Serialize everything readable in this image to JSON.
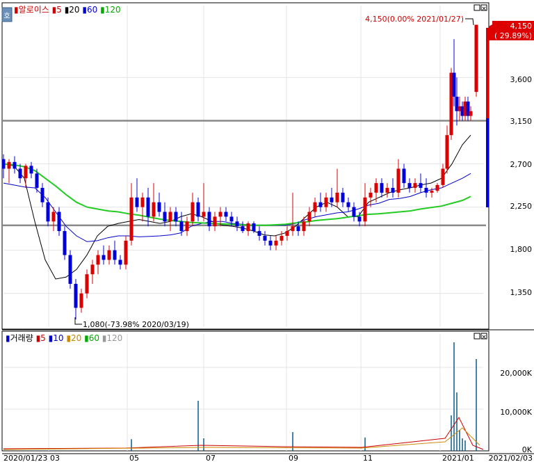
{
  "price_panel": {
    "legend": [
      {
        "text": "알로이스",
        "color": "#cc0000"
      },
      {
        "text": "5",
        "color": "#cc0000"
      },
      {
        "text": "20",
        "color": "#000000"
      },
      {
        "text": "60",
        "color": "#0000cc"
      },
      {
        "text": "120",
        "color": "#00aa00"
      }
    ],
    "side_button": "호",
    "high_annotation": "4,150(0.00% 2021/01/27)",
    "low_annotation": "1,080(-73.98% 2020/03/19)",
    "current_price": "4,150",
    "current_change": "( 29.89%)",
    "y_ticks": [
      "3,600",
      "3,150",
      "2,700",
      "2,250",
      "1,800",
      "1,350"
    ]
  },
  "volume_panel": {
    "legend": [
      {
        "text": "거래량",
        "color": "#000000"
      },
      {
        "text": "5",
        "color": "#cc0000"
      },
      {
        "text": "10",
        "color": "#0000cc"
      },
      {
        "text": "20",
        "color": "#cc8800"
      },
      {
        "text": "60",
        "color": "#00aa00"
      },
      {
        "text": "120",
        "color": "#999999"
      }
    ],
    "y_ticks": [
      "20,000K",
      "10,000K",
      "0K"
    ]
  },
  "x_axis": {
    "labels": [
      "2020/01/23",
      "03",
      "05",
      "07",
      "09",
      "11",
      "2021/01",
      "2021/02/03"
    ]
  },
  "colors": {
    "up": "#dd0000",
    "down": "#0000dd",
    "ma5": "#cc0000",
    "ma20": "#000000",
    "ma60": "#0000cc",
    "ma120": "#22cc22",
    "hline": "#888888"
  },
  "chart_data": {
    "type": "candlestick",
    "y_range": [
      1000,
      4350
    ],
    "volume_y_range_k": [
      0,
      28000
    ],
    "horizontal_lines": [
      3150,
      2060
    ],
    "high": {
      "value": 4150,
      "date": "2021/01/27"
    },
    "low": {
      "value": 1080,
      "date": "2020/03/19"
    },
    "last_close": 4150,
    "ma_series": {
      "ma20": [
        [
          0,
          2700
        ],
        [
          15,
          2680
        ],
        [
          30,
          2550
        ],
        [
          45,
          2100
        ],
        [
          60,
          1700
        ],
        [
          75,
          1500
        ],
        [
          90,
          1520
        ],
        [
          105,
          1600
        ],
        [
          120,
          1750
        ],
        [
          135,
          1950
        ],
        [
          150,
          2050
        ],
        [
          165,
          2080
        ],
        [
          180,
          2100
        ],
        [
          195,
          2120
        ],
        [
          210,
          2100
        ],
        [
          225,
          2080
        ],
        [
          240,
          2100
        ],
        [
          255,
          2150
        ],
        [
          270,
          2180
        ],
        [
          285,
          2150
        ],
        [
          300,
          2100
        ],
        [
          315,
          2060
        ],
        [
          330,
          2050
        ],
        [
          345,
          2030
        ],
        [
          360,
          2000
        ],
        [
          375,
          1960
        ],
        [
          390,
          1950
        ],
        [
          405,
          1980
        ],
        [
          420,
          2050
        ],
        [
          435,
          2150
        ],
        [
          450,
          2250
        ],
        [
          465,
          2300
        ],
        [
          480,
          2250
        ],
        [
          495,
          2150
        ],
        [
          510,
          2150
        ],
        [
          525,
          2300
        ],
        [
          540,
          2350
        ],
        [
          555,
          2400
        ],
        [
          570,
          2430
        ],
        [
          585,
          2450
        ],
        [
          600,
          2480
        ],
        [
          615,
          2500
        ],
        [
          630,
          2550
        ],
        [
          645,
          2700
        ],
        [
          660,
          2900
        ],
        [
          672,
          3000
        ]
      ],
      "ma60": [
        [
          0,
          2500
        ],
        [
          15,
          2480
        ],
        [
          30,
          2460
        ],
        [
          45,
          2450
        ],
        [
          60,
          2350
        ],
        [
          75,
          2200
        ],
        [
          90,
          2050
        ],
        [
          105,
          1950
        ],
        [
          120,
          1890
        ],
        [
          135,
          1900
        ],
        [
          150,
          1930
        ],
        [
          165,
          1950
        ],
        [
          180,
          1950
        ],
        [
          195,
          1940
        ],
        [
          210,
          1945
        ],
        [
          225,
          1950
        ],
        [
          240,
          1960
        ],
        [
          255,
          1980
        ],
        [
          270,
          2050
        ],
        [
          285,
          2080
        ],
        [
          300,
          2100
        ],
        [
          315,
          2100
        ],
        [
          330,
          2080
        ],
        [
          345,
          2070
        ],
        [
          360,
          2060
        ],
        [
          375,
          2060
        ],
        [
          390,
          2060
        ],
        [
          405,
          2060
        ],
        [
          420,
          2080
        ],
        [
          435,
          2120
        ],
        [
          450,
          2150
        ],
        [
          465,
          2170
        ],
        [
          480,
          2190
        ],
        [
          495,
          2200
        ],
        [
          510,
          2230
        ],
        [
          525,
          2270
        ],
        [
          540,
          2290
        ],
        [
          555,
          2330
        ],
        [
          570,
          2340
        ],
        [
          585,
          2360
        ],
        [
          600,
          2400
        ],
        [
          615,
          2430
        ],
        [
          630,
          2450
        ],
        [
          645,
          2500
        ],
        [
          660,
          2550
        ],
        [
          672,
          2600
        ]
      ],
      "ma120": [
        [
          0,
          2700
        ],
        [
          15,
          2690
        ],
        [
          30,
          2670
        ],
        [
          45,
          2630
        ],
        [
          60,
          2550
        ],
        [
          75,
          2470
        ],
        [
          90,
          2380
        ],
        [
          105,
          2300
        ],
        [
          120,
          2250
        ],
        [
          135,
          2230
        ],
        [
          150,
          2210
        ],
        [
          165,
          2200
        ],
        [
          180,
          2180
        ],
        [
          195,
          2165
        ],
        [
          210,
          2145
        ],
        [
          225,
          2125
        ],
        [
          240,
          2110
        ],
        [
          255,
          2100
        ],
        [
          270,
          2090
        ],
        [
          285,
          2085
        ],
        [
          300,
          2080
        ],
        [
          315,
          2075
        ],
        [
          330,
          2070
        ],
        [
          345,
          2065
        ],
        [
          360,
          2060
        ],
        [
          375,
          2060
        ],
        [
          390,
          2065
        ],
        [
          405,
          2070
        ],
        [
          420,
          2085
        ],
        [
          435,
          2095
        ],
        [
          450,
          2110
        ],
        [
          465,
          2120
        ],
        [
          480,
          2130
        ],
        [
          495,
          2145
        ],
        [
          510,
          2160
        ],
        [
          525,
          2175
        ],
        [
          540,
          2180
        ],
        [
          555,
          2190
        ],
        [
          570,
          2200
        ],
        [
          585,
          2210
        ],
        [
          600,
          2230
        ],
        [
          615,
          2245
        ],
        [
          630,
          2260
        ],
        [
          645,
          2290
        ],
        [
          660,
          2320
        ],
        [
          672,
          2360
        ]
      ]
    },
    "candles": [
      [
        0,
        2750,
        2800,
        2550,
        2650
      ],
      [
        8,
        2650,
        2750,
        2500,
        2720
      ],
      [
        16,
        2720,
        2780,
        2600,
        2650
      ],
      [
        24,
        2650,
        2700,
        2500,
        2550
      ],
      [
        32,
        2550,
        2700,
        2450,
        2680
      ],
      [
        40,
        2680,
        2720,
        2550,
        2600
      ],
      [
        48,
        2600,
        2650,
        2400,
        2450
      ],
      [
        56,
        2450,
        2500,
        2250,
        2300
      ],
      [
        64,
        2300,
        2350,
        2050,
        2100
      ],
      [
        72,
        2100,
        2250,
        2000,
        2200
      ],
      [
        80,
        2200,
        2250,
        1950,
        2000
      ],
      [
        88,
        2000,
        2050,
        1700,
        1750
      ],
      [
        96,
        1750,
        1800,
        1400,
        1450
      ],
      [
        104,
        1450,
        1500,
        1080,
        1200
      ],
      [
        112,
        1200,
        1400,
        1150,
        1350
      ],
      [
        120,
        1350,
        1600,
        1300,
        1550
      ],
      [
        128,
        1550,
        1700,
        1450,
        1650
      ],
      [
        136,
        1650,
        1800,
        1550,
        1750
      ],
      [
        144,
        1750,
        1850,
        1650,
        1700
      ],
      [
        152,
        1700,
        1850,
        1650,
        1800
      ],
      [
        160,
        1800,
        1900,
        1650,
        1700
      ],
      [
        168,
        1700,
        1750,
        1600,
        1650
      ],
      [
        176,
        1650,
        1950,
        1600,
        1900
      ],
      [
        184,
        1900,
        2500,
        1850,
        2350
      ],
      [
        192,
        2350,
        2550,
        2200,
        2250
      ],
      [
        200,
        2250,
        2400,
        2100,
        2350
      ],
      [
        208,
        2350,
        2450,
        2050,
        2150
      ],
      [
        216,
        2150,
        2500,
        2100,
        2300
      ],
      [
        224,
        2300,
        2400,
        2150,
        2200
      ],
      [
        232,
        2200,
        2300,
        2050,
        2100
      ],
      [
        240,
        2100,
        2250,
        2000,
        2200
      ],
      [
        248,
        2200,
        2250,
        2050,
        2100
      ],
      [
        256,
        2100,
        2200,
        1950,
        2000
      ],
      [
        264,
        2000,
        2150,
        1950,
        2100
      ],
      [
        272,
        2100,
        2400,
        2050,
        2300
      ],
      [
        280,
        2300,
        2350,
        2100,
        2150
      ],
      [
        288,
        2150,
        2500,
        2100,
        2200
      ],
      [
        296,
        2200,
        2250,
        2000,
        2050
      ],
      [
        304,
        2050,
        2200,
        2000,
        2150
      ],
      [
        312,
        2150,
        2250,
        2050,
        2200
      ],
      [
        320,
        2200,
        2250,
        2100,
        2150
      ],
      [
        328,
        2150,
        2200,
        2050,
        2100
      ],
      [
        336,
        2100,
        2150,
        2000,
        2050
      ],
      [
        344,
        2050,
        2100,
        1980,
        2000
      ],
      [
        352,
        2000,
        2100,
        1950,
        2080
      ],
      [
        360,
        2080,
        2100,
        1980,
        2000
      ],
      [
        368,
        2000,
        2050,
        1900,
        1950
      ],
      [
        376,
        1950,
        2000,
        1850,
        1900
      ],
      [
        384,
        1900,
        1950,
        1800,
        1850
      ],
      [
        392,
        1850,
        1950,
        1800,
        1900
      ],
      [
        400,
        1900,
        2000,
        1850,
        1950
      ],
      [
        408,
        1950,
        2050,
        1900,
        2000
      ],
      [
        416,
        2000,
        2400,
        1950,
        2050
      ],
      [
        424,
        2050,
        2100,
        1950,
        2000
      ],
      [
        432,
        2000,
        2150,
        1950,
        2100
      ],
      [
        440,
        2100,
        2250,
        2050,
        2200
      ],
      [
        448,
        2200,
        2350,
        2150,
        2300
      ],
      [
        456,
        2300,
        2400,
        2200,
        2250
      ],
      [
        464,
        2250,
        2400,
        2200,
        2350
      ],
      [
        472,
        2350,
        2450,
        2250,
        2300
      ],
      [
        480,
        2300,
        2650,
        2250,
        2400
      ],
      [
        488,
        2400,
        2450,
        2250,
        2300
      ],
      [
        496,
        2300,
        2350,
        2200,
        2250
      ],
      [
        504,
        2250,
        2300,
        2100,
        2150
      ],
      [
        512,
        2150,
        2200,
        2050,
        2100
      ],
      [
        520,
        2100,
        2500,
        2050,
        2350
      ],
      [
        528,
        2350,
        2450,
        2250,
        2400
      ],
      [
        536,
        2400,
        2550,
        2300,
        2500
      ],
      [
        544,
        2500,
        2550,
        2350,
        2400
      ],
      [
        552,
        2400,
        2500,
        2350,
        2450
      ],
      [
        560,
        2450,
        2550,
        2350,
        2400
      ],
      [
        568,
        2400,
        2750,
        2350,
        2650
      ],
      [
        576,
        2650,
        2700,
        2450,
        2500
      ],
      [
        584,
        2500,
        2550,
        2400,
        2450
      ],
      [
        592,
        2450,
        2550,
        2400,
        2500
      ],
      [
        600,
        2500,
        2600,
        2400,
        2450
      ],
      [
        608,
        2450,
        2550,
        2350,
        2400
      ],
      [
        616,
        2400,
        2450,
        2350,
        2420
      ],
      [
        624,
        2420,
        2500,
        2400,
        2480
      ],
      [
        632,
        2480,
        2700,
        2450,
        2650
      ],
      [
        638,
        2650,
        3100,
        2600,
        3000
      ],
      [
        644,
        3000,
        3700,
        2950,
        3650
      ],
      [
        648,
        3650,
        4000,
        3300,
        3400
      ],
      [
        652,
        3400,
        3600,
        3100,
        3250
      ],
      [
        656,
        3250,
        3400,
        3150,
        3300
      ],
      [
        660,
        3300,
        3350,
        3150,
        3200
      ],
      [
        664,
        3200,
        3400,
        3150,
        3350
      ],
      [
        668,
        3350,
        3400,
        3150,
        3200
      ],
      [
        672,
        3200,
        3300,
        3150,
        3250
      ],
      [
        680,
        3450,
        4150,
        3400,
        4150
      ]
    ],
    "volumes_k": [
      [
        184,
        2800
      ],
      [
        280,
        12000
      ],
      [
        288,
        3000
      ],
      [
        416,
        4500
      ],
      [
        520,
        3200
      ],
      [
        644,
        8500
      ],
      [
        648,
        26000
      ],
      [
        652,
        14000
      ],
      [
        656,
        5000
      ],
      [
        660,
        3000
      ],
      [
        664,
        2500
      ],
      [
        680,
        22000
      ]
    ]
  }
}
